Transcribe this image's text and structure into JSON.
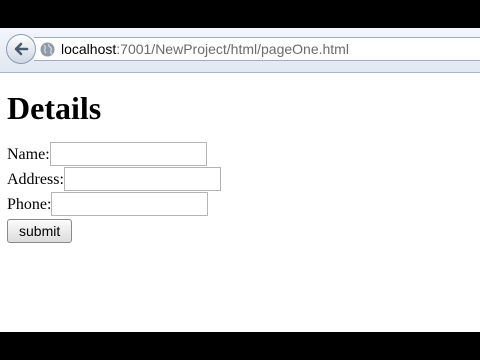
{
  "browser": {
    "url_host": "localhost",
    "url_rest": ":7001/NewProject/html/pageOne.html"
  },
  "page": {
    "heading": "Details",
    "fields": [
      {
        "label": "Name:",
        "value": ""
      },
      {
        "label": "Address:",
        "value": ""
      },
      {
        "label": "Phone:",
        "value": ""
      }
    ],
    "submit_label": "submit"
  }
}
